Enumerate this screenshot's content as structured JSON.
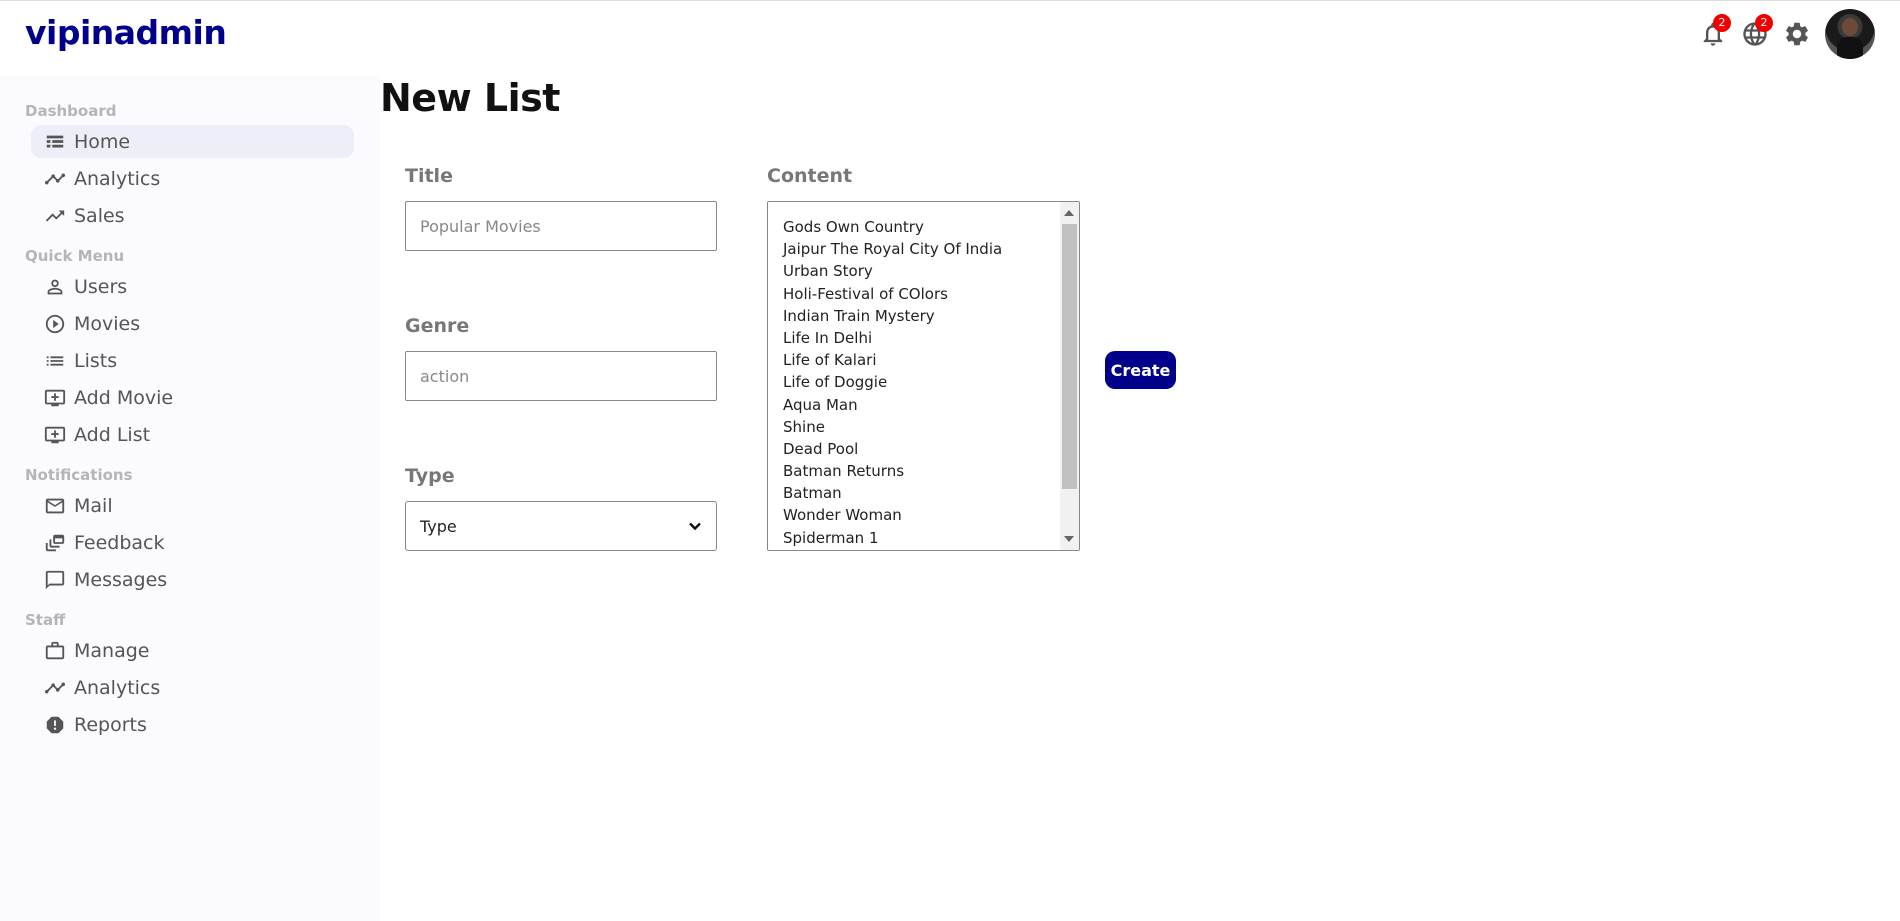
{
  "app": {
    "logo": "vipinadmin"
  },
  "topbar": {
    "notifications_badge": "2",
    "language_badge": "2"
  },
  "sidebar": {
    "sections": [
      {
        "title": "Dashboard",
        "items": [
          {
            "label": "Home",
            "icon": "home-icon",
            "active": true
          },
          {
            "label": "Analytics",
            "icon": "timeline-icon"
          },
          {
            "label": "Sales",
            "icon": "trending-up-icon"
          }
        ]
      },
      {
        "title": "Quick Menu",
        "items": [
          {
            "label": "Users",
            "icon": "user-icon"
          },
          {
            "label": "Movies",
            "icon": "play-circle-icon"
          },
          {
            "label": "Lists",
            "icon": "list-icon"
          },
          {
            "label": "Add Movie",
            "icon": "add-to-queue-icon"
          },
          {
            "label": "Add List",
            "icon": "add-to-queue-icon"
          }
        ]
      },
      {
        "title": "Notifications",
        "items": [
          {
            "label": "Mail",
            "icon": "mail-icon"
          },
          {
            "label": "Feedback",
            "icon": "dynamic-feed-icon"
          },
          {
            "label": "Messages",
            "icon": "chat-bubble-icon"
          }
        ]
      },
      {
        "title": "Staff",
        "items": [
          {
            "label": "Manage",
            "icon": "work-icon"
          },
          {
            "label": "Analytics",
            "icon": "timeline-icon"
          },
          {
            "label": "Reports",
            "icon": "report-icon"
          }
        ]
      }
    ]
  },
  "main": {
    "page_title": "New List",
    "title_label": "Title",
    "title_placeholder": "Popular Movies",
    "genre_label": "Genre",
    "genre_placeholder": "action",
    "type_label": "Type",
    "type_selected": "Type",
    "content_label": "Content",
    "content_options": [
      "Gods Own Country",
      "Jaipur The Royal City Of India",
      "Urban Story",
      "Holi-Festival of COlors",
      "Indian Train Mystery",
      "Life In Delhi",
      "Life of Kalari",
      "Life of Doggie",
      "Aqua Man",
      "Shine",
      "Dead Pool",
      "Batman Returns",
      "Batman",
      "Wonder Woman",
      "Spiderman 1"
    ],
    "create_label": "Create"
  }
}
